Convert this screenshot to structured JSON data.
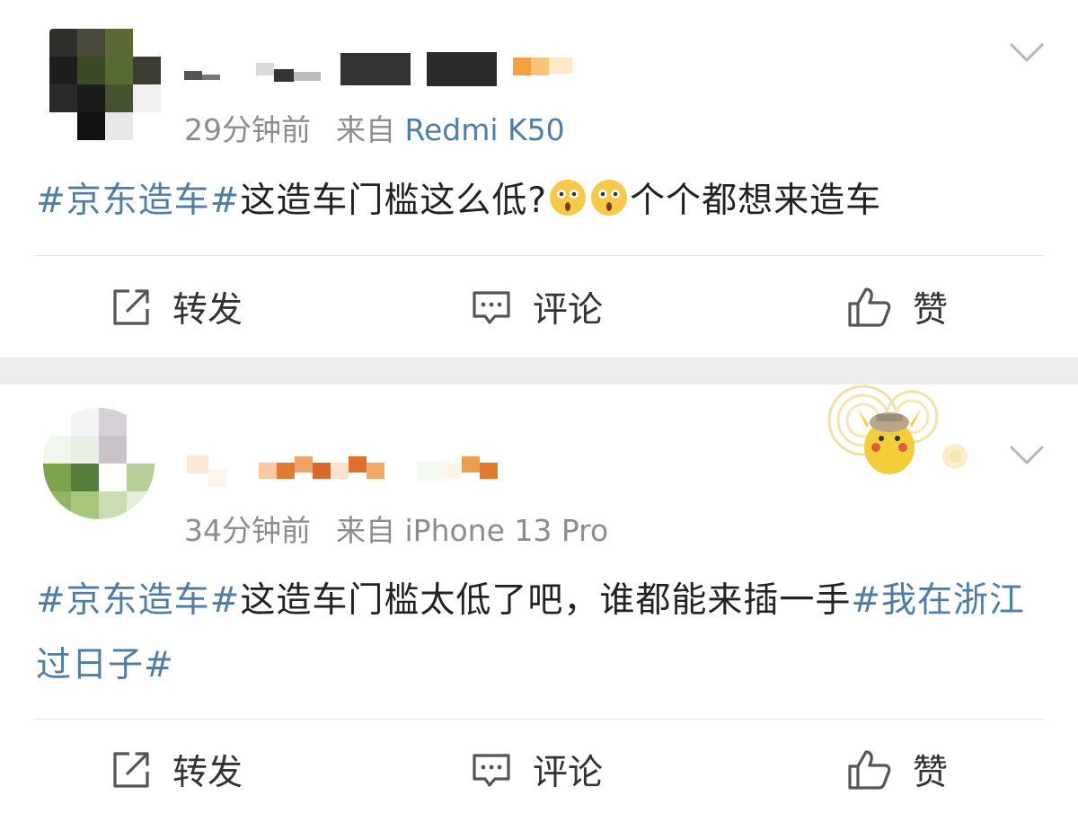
{
  "posts": [
    {
      "time": "29分钟前",
      "source_prefix": "来自",
      "device": "Redmi K50",
      "content": {
        "tag": "#京东造车#",
        "text_a": "这造车门槛这么低?",
        "emoji_name": "surprised-face-emoji",
        "text_b": "个个都想来造车"
      },
      "actions": {
        "repost": "转发",
        "comment": "评论",
        "like": "赞"
      }
    },
    {
      "time": "34分钟前",
      "source_prefix": "来自",
      "device": "iPhone 13 Pro",
      "content": {
        "tag": "#京东造车#",
        "text_a": "这造车门槛太低了吧，谁都能来插一手",
        "tag2": "#我在浙江过日子#"
      },
      "actions": {
        "repost": "转发",
        "comment": "评论",
        "like": "赞"
      }
    }
  ],
  "colors": {
    "link": "#4f7da5",
    "meta_gray": "#8c8c8c",
    "separator": "#ededed",
    "text": "#222222"
  },
  "icons": [
    "repost-icon",
    "comment-icon",
    "like-icon",
    "chevron-down-icon",
    "surprised-face-emoji",
    "pikachu-badge"
  ]
}
